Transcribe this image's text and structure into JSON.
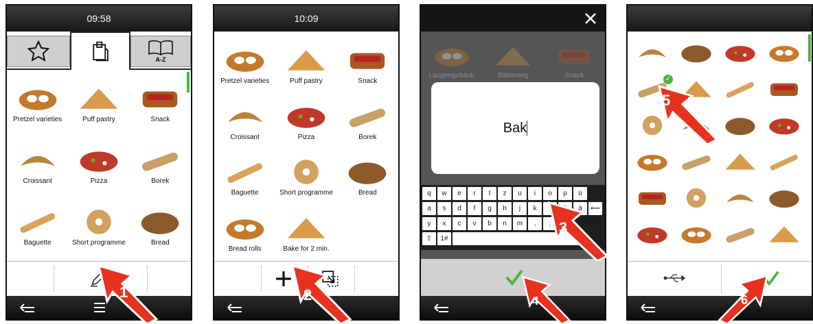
{
  "colors": {
    "accent_green": "#4bb543",
    "arrow_red": "#e8321f"
  },
  "screen1": {
    "time": "09:58",
    "tabs": [
      {
        "icon": "star-icon"
      },
      {
        "icon": "clipboard-icon"
      },
      {
        "icon": "book-az-icon",
        "label": "A-Z"
      }
    ],
    "items": [
      "Pretzel varieties",
      "Puff pastry",
      "Snack",
      "Croissant",
      "Pizza",
      "Borek",
      "Baguette",
      "Short programme",
      "Bread"
    ],
    "toolbar_icon": "pencil-icon",
    "step": "1"
  },
  "screen2": {
    "time": "10:09",
    "items": [
      "Pretzel varieties",
      "Puff pastry",
      "Snack",
      "Croissant",
      "Pizza",
      "Borek",
      "Baguette",
      "Short programme",
      "Bread",
      "Bread rolls",
      "Bake for 2 min."
    ],
    "toolbar_icons": [
      "plus-icon",
      "select-area-icon"
    ],
    "step": "2"
  },
  "screen3": {
    "bg_labels": [
      "Laugengebäck",
      "Blätterteig",
      "Snack"
    ],
    "input_text": "Bak",
    "keyboard": [
      [
        "q",
        "w",
        "e",
        "r",
        "t",
        "z",
        "u",
        "i",
        "o",
        "p",
        "ü"
      ],
      [
        "a",
        "s",
        "d",
        "f",
        "g",
        "h",
        "j",
        "k",
        "l",
        "ö",
        "ä",
        "⟸"
      ],
      [
        "y",
        "x",
        "c",
        "v",
        "b",
        "n",
        "m",
        ",",
        ".",
        "-"
      ],
      [
        "⇧",
        "1#"
      ]
    ],
    "step_keyboard": "3",
    "step_confirm": "4"
  },
  "screen4": {
    "toolbar_icons": [
      "usb-icon",
      "checkmark-icon"
    ],
    "step_select": "5",
    "step_confirm": "6"
  }
}
